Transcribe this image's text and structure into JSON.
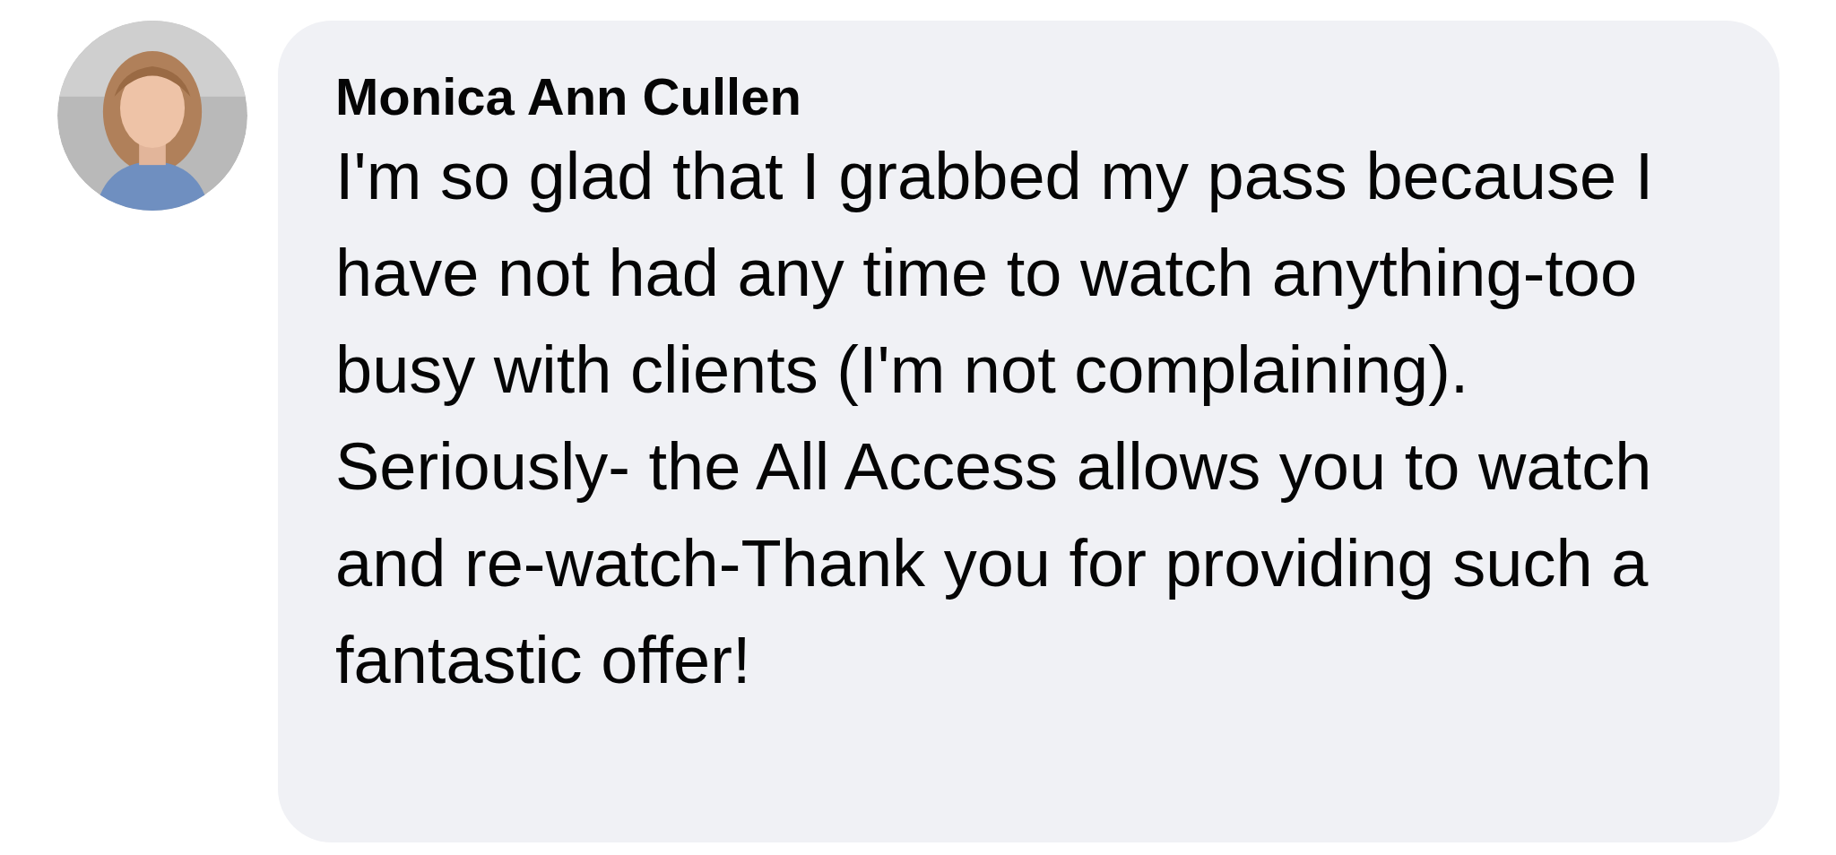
{
  "comment": {
    "author": "Monica Ann Cullen",
    "text": "I'm so glad that I grabbed my pass because I have not had any time to watch anything-too busy with clients (I'm not complaining). Seriously- the All Access allows you to watch and re-watch-Thank you for providing such a fantastic offer!"
  }
}
